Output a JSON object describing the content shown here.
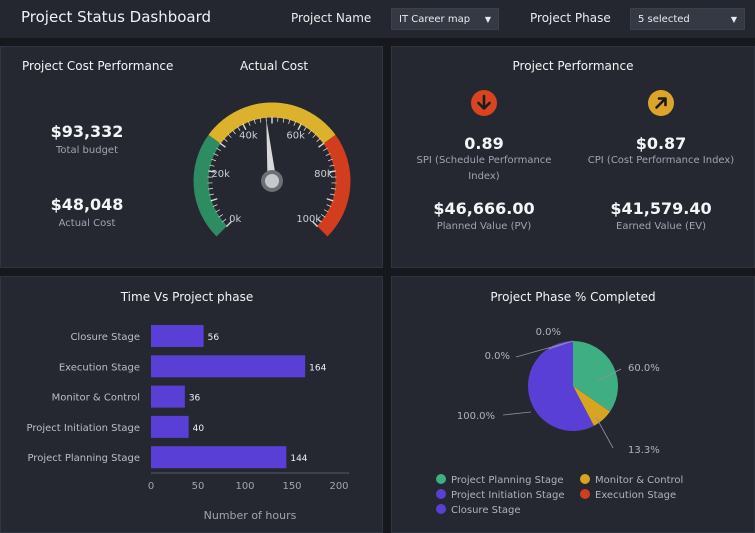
{
  "header": {
    "title": "Project Status Dashboard",
    "project_name_label": "Project Name",
    "project_name_value": "IT Career map",
    "project_phase_label": "Project Phase",
    "project_phase_value": "5 selected"
  },
  "cost": {
    "title": "Project Cost Performance",
    "total_budget_value": "$93,332",
    "total_budget_label": "Total budget",
    "actual_cost_value": "$48,048",
    "actual_cost_label": "Actual Cost",
    "gauge_title": "Actual Cost",
    "gauge": {
      "min": 0,
      "max": 100000,
      "value": 48048,
      "ticks": [
        "0k",
        "20k",
        "40k",
        "60k",
        "80k",
        "100k"
      ],
      "colors": {
        "green": "#2e8c62",
        "yellow": "#dcb12c",
        "red": "#d23c1f",
        "needle": "#d9d9d9"
      }
    }
  },
  "performance": {
    "title": "Project Performance",
    "spi_value": "0.89",
    "spi_label": "SPI (Schedule Performance Index)",
    "cpi_value": "$0.87",
    "cpi_label": "CPI (Cost Performance Index)",
    "pv_value": "$46,666.00",
    "pv_label": "Planned Value (PV)",
    "ev_value": "$41,579.40",
    "ev_label": "Earned Value (EV)",
    "spi_icon_color": "#d7441f",
    "cpi_icon_color": "#dca52a"
  },
  "time_chart": {
    "title": "Time Vs Project phase",
    "chart_data": {
      "type": "bar",
      "orientation": "horizontal",
      "categories": [
        "Closure Stage",
        "Execution Stage",
        "Monitor & Control",
        "Project Initiation Stage",
        "Project Planning Stage"
      ],
      "values": [
        56,
        164,
        36,
        40,
        144
      ],
      "xlabel": "Number of hours",
      "xlim": [
        0,
        200
      ],
      "xticks": [
        0,
        50,
        100,
        150,
        200
      ],
      "color": "#5a3fd6"
    }
  },
  "phase_chart": {
    "title": "Project Phase % Completed",
    "chart_data": {
      "type": "pie",
      "labels": [
        "Project Planning Stage",
        "Monitor & Control",
        "Project Initiation Stage",
        "Execution Stage",
        "Closure Stage"
      ],
      "values": [
        60.0,
        13.3,
        100.0,
        0.0,
        0.0
      ],
      "value_labels": [
        "60.0%",
        "13.3%",
        "100.0%",
        "0.0%",
        "0.0%"
      ],
      "colors": [
        "#3fae82",
        "#d7a521",
        "#5a3fd6",
        "#d13d20",
        "#5a3fd6"
      ]
    }
  }
}
